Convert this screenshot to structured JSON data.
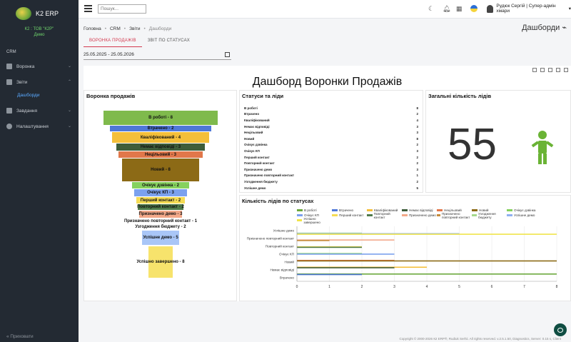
{
  "app": {
    "name": "K2 ERP",
    "company_line1": "К2 : ТОВ \"К2Р\"",
    "company_line2": "Демо"
  },
  "sidebar": {
    "section": "CRM",
    "items": [
      {
        "label": "Воронка",
        "has_children": true
      },
      {
        "label": "Звіти",
        "has_children": true
      },
      {
        "label": "Завдання",
        "has_children": true
      },
      {
        "label": "Налаштування",
        "has_children": true
      }
    ],
    "sub_item": "Дашборди",
    "hide_label": "«  Приховати"
  },
  "topbar": {
    "search_placeholder": "Пошук...",
    "user": "Рудюк Сергій | Супер-адмін хмари"
  },
  "breadcrumb": {
    "items": [
      "Головна",
      "CRM",
      "Звіти",
      "Дашборди"
    ],
    "sep": "•"
  },
  "page_title": "Дашборди",
  "tabs": [
    {
      "label": "ВОРОНКА ПРОДАЖІВ",
      "active": true
    },
    {
      "label": "ЗВІТ ПО СТАТУСАХ",
      "active": false
    }
  ],
  "date_range": "25.05.2025 - 25.05.2026",
  "dashboard": {
    "title": "Дашборд Воронки Продажів",
    "funnel_title": "Воронка продажів",
    "funnel": [
      {
        "label": "В роботі - 8",
        "color": "#7fba4c"
      },
      {
        "label": "Втрачено - 2",
        "color": "#4f78d8"
      },
      {
        "label": "Кваліфікований - 4",
        "color": "#f4bf3a"
      },
      {
        "label": "Немає відповіді - 3",
        "color": "#3e5d3a"
      },
      {
        "label": "Нецільовий - 3",
        "color": "#e1774a"
      },
      {
        "label": "Новий - 8",
        "color": "#8c6a16"
      },
      {
        "label": "Очікує дзвінка - 2",
        "color": "#86d15e"
      },
      {
        "label": "Очікує КП - 3",
        "color": "#7ba1ee"
      },
      {
        "label": "Перший контакт - 2",
        "color": "#f5dc55"
      },
      {
        "label": "Повторний контакт - 2",
        "color": "#4f7a4a"
      },
      {
        "label": "Призначено демо - 3",
        "color": "#f3a98a"
      },
      {
        "label": "Призначено повторний контакт - 1",
        "color": "#ffffff"
      },
      {
        "label": "Узгодження бюджету - 2",
        "color": "#ffffff"
      },
      {
        "label": "Успішне демо - 5",
        "color": "#a9c6f7"
      },
      {
        "label": "Успішно завершено - 8",
        "color": "#f7e36c"
      }
    ],
    "statuses_title": "Статуси та ліди",
    "statuses": [
      {
        "name": "В роботі",
        "count": "8"
      },
      {
        "name": "Втрачено",
        "count": "2"
      },
      {
        "name": "Кваліфікований",
        "count": "4"
      },
      {
        "name": "Немає відповіді",
        "count": "3"
      },
      {
        "name": "Нецільовий",
        "count": "3"
      },
      {
        "name": "Новий",
        "count": "8"
      },
      {
        "name": "Очікує дзвінка",
        "count": "2"
      },
      {
        "name": "Очікує КП",
        "count": "3"
      },
      {
        "name": "Перший контакт",
        "count": "2"
      },
      {
        "name": "Повторний контакт",
        "count": "2"
      },
      {
        "name": "Призначено демо",
        "count": "3"
      },
      {
        "name": "Призначено повторний контакт",
        "count": "1"
      },
      {
        "name": "Узгодження бюджету",
        "count": "2"
      },
      {
        "name": "Успішне демо",
        "count": "5"
      },
      {
        "name": "Успішно завершено",
        "count": "8"
      }
    ],
    "total_title": "Загальні кількість лідів",
    "total": "55",
    "bar_title": "Кількість лідів по статусах"
  },
  "chart_data": {
    "type": "bar",
    "orientation": "horizontal",
    "categories": [
      "Успішне демо",
      "Призначено повторний контакт",
      "Повторний контакт",
      "Очікує КП",
      "Новий",
      "Немає відповіді",
      "Втрачено"
    ],
    "series": [
      {
        "name": "В роботі",
        "color": "#6ca83c",
        "values": [
          0,
          0,
          0,
          0,
          0,
          0,
          8
        ]
      },
      {
        "name": "Втрачено",
        "color": "#4f78d8",
        "values": [
          0,
          0,
          0,
          0,
          0,
          0,
          2
        ]
      },
      {
        "name": "Кваліфікований",
        "color": "#f4bf3a",
        "values": [
          0,
          0,
          0,
          0,
          0,
          4,
          0
        ]
      },
      {
        "name": "Немає відповіді",
        "color": "#3e5d3a",
        "values": [
          0,
          0,
          0,
          0,
          0,
          3,
          0
        ]
      },
      {
        "name": "Нецільовий",
        "color": "#e1774a",
        "values": [
          0,
          0,
          0,
          0,
          3,
          0,
          0
        ]
      },
      {
        "name": "Новий",
        "color": "#8c6a16",
        "values": [
          0,
          0,
          0,
          0,
          8,
          0,
          0
        ]
      },
      {
        "name": "Очікує дзвінка",
        "color": "#86d15e",
        "values": [
          0,
          0,
          0,
          2,
          0,
          0,
          0
        ]
      },
      {
        "name": "Очікує КП",
        "color": "#7ba1ee",
        "values": [
          0,
          0,
          0,
          3,
          0,
          0,
          0
        ]
      },
      {
        "name": "Перший контакт",
        "color": "#f5dc55",
        "values": [
          0,
          0,
          2,
          0,
          0,
          0,
          0
        ]
      },
      {
        "name": "Повторний контакт",
        "color": "#4f7a4a",
        "values": [
          0,
          0,
          2,
          0,
          0,
          0,
          0
        ]
      },
      {
        "name": "Призначено демо",
        "color": "#f3a98a",
        "values": [
          0,
          3,
          0,
          0,
          0,
          0,
          0
        ]
      },
      {
        "name": "Призначено повторний контакт",
        "color": "#c48a3a",
        "values": [
          0,
          1,
          0,
          0,
          0,
          0,
          0
        ]
      },
      {
        "name": "Узгодження бюджету",
        "color": "#a6d98c",
        "values": [
          2,
          0,
          0,
          0,
          0,
          0,
          0
        ]
      },
      {
        "name": "Успішне демо",
        "color": "#8fb0f0",
        "values": [
          5,
          0,
          0,
          0,
          0,
          0,
          0
        ]
      },
      {
        "name": "Успішно завершено",
        "color": "#f0e44a",
        "values": [
          8,
          0,
          0,
          0,
          0,
          0,
          0
        ]
      }
    ],
    "xticks": [
      "0",
      "1",
      "2",
      "3",
      "4",
      "5",
      "6",
      "7",
      "8"
    ],
    "xlim": [
      0,
      8
    ],
    "legend": "top"
  },
  "footer": "Copyright © 2000-2026 К2 ERP®, Rudiuk Serhii. All rights reserved. v.2.5.1.50, Diagnostics, Server: 0.15 s, Client"
}
